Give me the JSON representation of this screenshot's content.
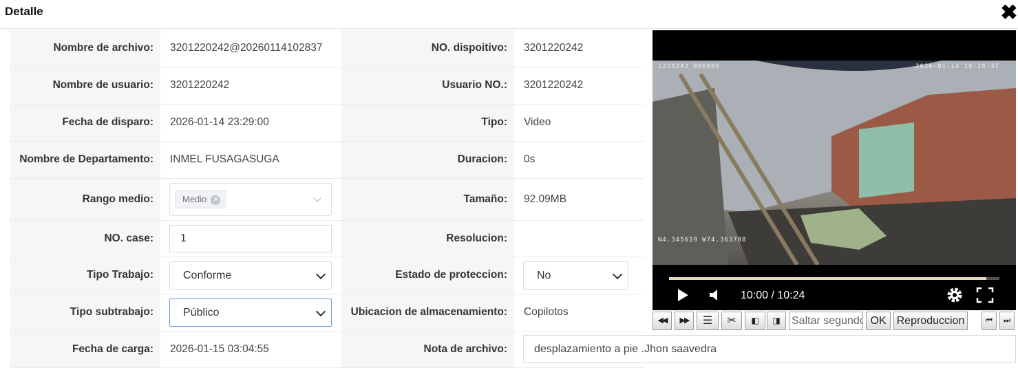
{
  "dialog": {
    "title": "Detalle"
  },
  "rows": {
    "r1": {
      "l1": "Nombre de archivo:",
      "v1": "3201220242@20260114102837",
      "l2": "NO. dispoitivo:",
      "v2": "3201220242"
    },
    "r2": {
      "l1": "Nombre de usuario:",
      "v1": "3201220242",
      "l2": "Usuario NO.:",
      "v2": "3201220242"
    },
    "r3": {
      "l1": "Fecha de disparo:",
      "v1": "2026-01-14 23:29:00",
      "l2": "Tipo:",
      "v2": "Video"
    },
    "r4": {
      "l1": "Nombre de Departamento:",
      "v1": "INMEL FUSAGASUGA",
      "l2": "Duracion:",
      "v2": "0s"
    },
    "r5": {
      "l1": "Rango medio:",
      "tag": "Medio",
      "l2": "Tamaño:",
      "v2": "92.09MB"
    },
    "r6": {
      "l1": "NO. case:",
      "case": "1",
      "l2": "Resolucion:",
      "v2": ""
    },
    "r7": {
      "l1": "Tipo Trabajo:",
      "sel": "Conforme",
      "l2": "Estado de proteccion:",
      "sel2": "No"
    },
    "r8": {
      "l1": "Tipo subtrabajo:",
      "sel": "Público",
      "l2": "Ubicacion de almacenamiento:",
      "v2": "Copilotos"
    },
    "r9": {
      "l1": "Fecha de carga:",
      "v1": "2026-01-15 03:04:55",
      "l2": "Nota de archivo:",
      "note": "desplazamiento a pie .Jhon saavedra"
    }
  },
  "player": {
    "osd_top_left": "1220242_000000",
    "osd_top_right": "2026-01-14 10:28:37",
    "osd_bottom_left": "N4.345639  W74.363708",
    "time": "10:00 / 10:24",
    "progress": 0.961,
    "icons": [
      "play-icon",
      "volume-icon",
      "gear-icon",
      "fullscreen-icon"
    ]
  },
  "toolbar": {
    "prev": "◀◀",
    "next": "▶▶",
    "seek_placeholder": "Saltar segundos",
    "ok": "OK",
    "playback": "Reproduccion",
    "first": "⏮",
    "last": "⏭"
  }
}
